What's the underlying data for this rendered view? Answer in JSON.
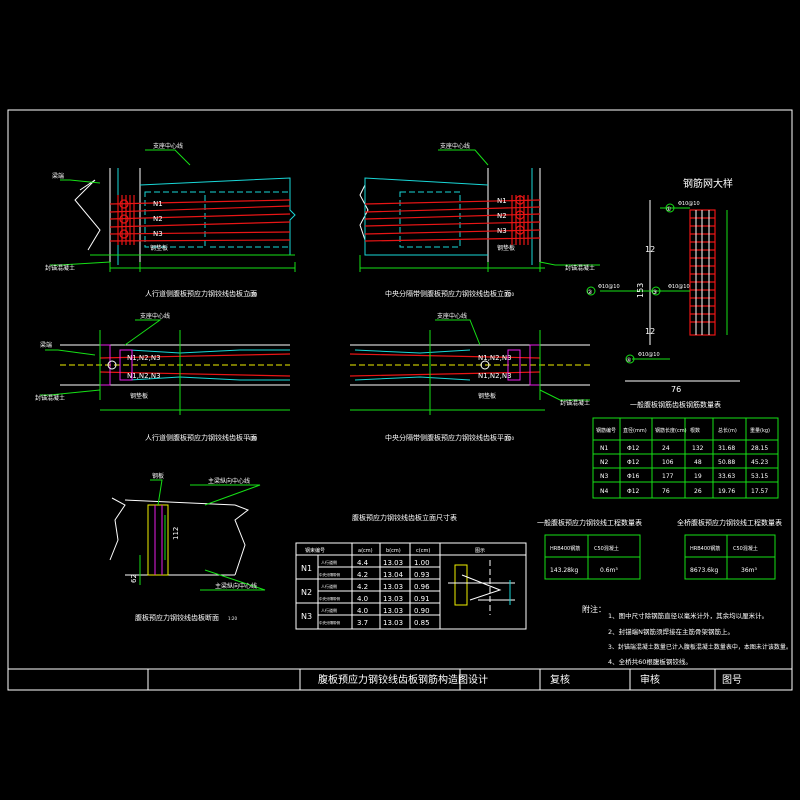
{
  "views": {
    "elev_left_title": "人行道侧腹板预应力钢铰线齿板立面",
    "elev_right_title": "中央分隔带侧腹板预应力钢铰线齿板立面",
    "plan_left_title": "人行道侧腹板预应力钢铰线齿板平面",
    "plan_right_title": "中央分隔带侧腹板预应力钢铰线齿板平面",
    "section_title": "腹板预应力钢铰线齿板断面",
    "scale_suffix": "1:20"
  },
  "labels": {
    "n1": "N1",
    "n2": "N2",
    "n3": "N3",
    "n123": "N1,N2,N3",
    "bearing_center_l": "支座中心线",
    "bearing_center_r": "支座中心线",
    "beam_end_l": "梁端",
    "anchor_end_l": "封锚混凝土",
    "anchor_end_r": "封锚混凝土",
    "plate_l": "钢垫板",
    "plate_r": "钢垫板",
    "plan_center_l": "支座中心线",
    "plan_center_r": "支座中心线",
    "plan_beam_end": "梁端",
    "plan_anchor_l": "封锚混凝土",
    "plan_anchor_r": "封锚混凝土",
    "plan_plate_l": "钢垫板",
    "plan_plate_r": "钢垫板",
    "sec_a": "钢板",
    "sec_b": "主梁纵向中心线",
    "sec_c": "主梁纵向中心线",
    "sec_dim1": "112",
    "sec_dim2": "62"
  },
  "rebar_detail": {
    "title": "钢筋网大样",
    "dim_12a": "12",
    "dim_12b": "12",
    "dim_153": "153",
    "dim_76": "76",
    "c1": "①",
    "c2": "②",
    "c3": "③",
    "c4": "④",
    "lbl1": "Φ10@10",
    "lbl2": "Φ10@10",
    "lbl3": "Φ10@10",
    "lbl4": "Φ10@10"
  },
  "table1": {
    "title": "一般腹板钢筋齿板钢筋数量表",
    "headers": [
      "钢筋编号",
      "直径(mm)",
      "钢筋长度(cm)",
      "根数",
      "总长(m)",
      "重量(kg)"
    ],
    "rows": [
      [
        "N1",
        "Φ12",
        "24",
        "132",
        "31.68",
        "28.15"
      ],
      [
        "N2",
        "Φ12",
        "106",
        "48",
        "50.88",
        "45.23"
      ],
      [
        "N3",
        "Φ16",
        "177",
        "19",
        "33.63",
        "53.15"
      ],
      [
        "N4",
        "Φ12",
        "76",
        "26",
        "19.76",
        "17.57"
      ]
    ]
  },
  "table2": {
    "title": "一般腹板预应力钢铰线工程数量表",
    "h1": "HRB400钢筋",
    "h2": "C50混凝土",
    "v1": "143.28kg",
    "v2": "0.6m³"
  },
  "table3": {
    "title": "全桥腹板预应力钢铰线工程数量表",
    "h1": "HRB400钢筋",
    "h2": "C50混凝土",
    "v1": "8673.6kg",
    "v2": "36m³"
  },
  "table4": {
    "title": "腹板预应力钢铰线齿板立面尺寸表",
    "headers": [
      "钢束编号",
      "a(cm)",
      "b(cm)",
      "c(cm)",
      "图示"
    ],
    "rows": [
      {
        "bundle": "N1",
        "side": "人行道侧",
        "a": "4.4",
        "b": "13.03",
        "c": "1.00"
      },
      {
        "bundle": "",
        "side": "中央分隔带侧",
        "a": "4.2",
        "b": "13.04",
        "c": "0.93"
      },
      {
        "bundle": "N2",
        "side": "人行道侧",
        "a": "4.2",
        "b": "13.03",
        "c": "0.96"
      },
      {
        "bundle": "",
        "side": "中央分隔带侧",
        "a": "4.0",
        "b": "13.03",
        "c": "0.91"
      },
      {
        "bundle": "N3",
        "side": "人行道侧",
        "a": "4.0",
        "b": "13.03",
        "c": "0.90"
      },
      {
        "bundle": "",
        "side": "中央分隔带侧",
        "a": "3.7",
        "b": "13.03",
        "c": "0.85"
      }
    ]
  },
  "notes": {
    "head": "附注：",
    "items": [
      "1、图中尺寸除钢筋直径以毫米计外，其余均以厘米计。",
      "2、封锚端N钢筋须焊接在主筋骨架钢筋上。",
      "3、封锚端混凝土数量已计入腹板混凝土数量表中，本图未计该数量。",
      "4、全桥共60根腹板钢铰线。"
    ]
  },
  "title_block": {
    "drawing_title": "腹板预应力钢铰线齿板钢筋构造图",
    "design": "设计",
    "check": "复核",
    "review": "审核",
    "drawing_no": "图号"
  }
}
